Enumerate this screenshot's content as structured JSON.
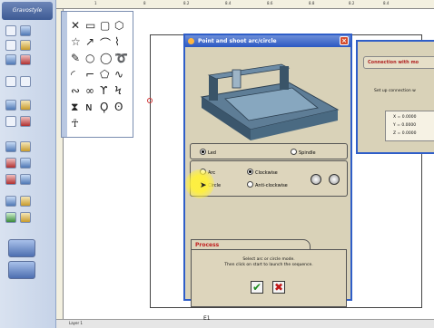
{
  "app": {
    "logo_text": "Gravostyle"
  },
  "ruler": {
    "ticks": [
      "1",
      "8",
      "8.2",
      "8.4",
      "8.6",
      "8.8",
      "8.2",
      "8.4"
    ]
  },
  "dialog": {
    "title": "Point and shoot arc/circle",
    "mode_options": {
      "led": "Led",
      "spindle": "Spindle"
    },
    "shape_options": {
      "arc": "Arc",
      "circle": "Circle"
    },
    "direction_options": {
      "clockwise": "Clockwise",
      "anticlockwise": "Anti-clockwise"
    },
    "process_title": "Process",
    "process_text_line1": "Select arc or circle mode.",
    "process_text_line2": "Then click on start to launch the sequence.",
    "ok_symbol": "✔",
    "cancel_symbol": "✖"
  },
  "connection_dialog": {
    "title": "Connection with mo",
    "text": "Set up connection w",
    "x": "X = 0.0000",
    "y": "Y = 0.0000",
    "z": "Z = 0.0000"
  },
  "status": {
    "layer": "Layer 1",
    "page": "E1"
  },
  "colors": {
    "title_bar": "#2b58c2",
    "dialog_bg": "#d9d2b8",
    "process_title": "#c02020",
    "ok": "#1e8c1e",
    "cancel": "#c01818",
    "highlight": "#fff03c"
  }
}
